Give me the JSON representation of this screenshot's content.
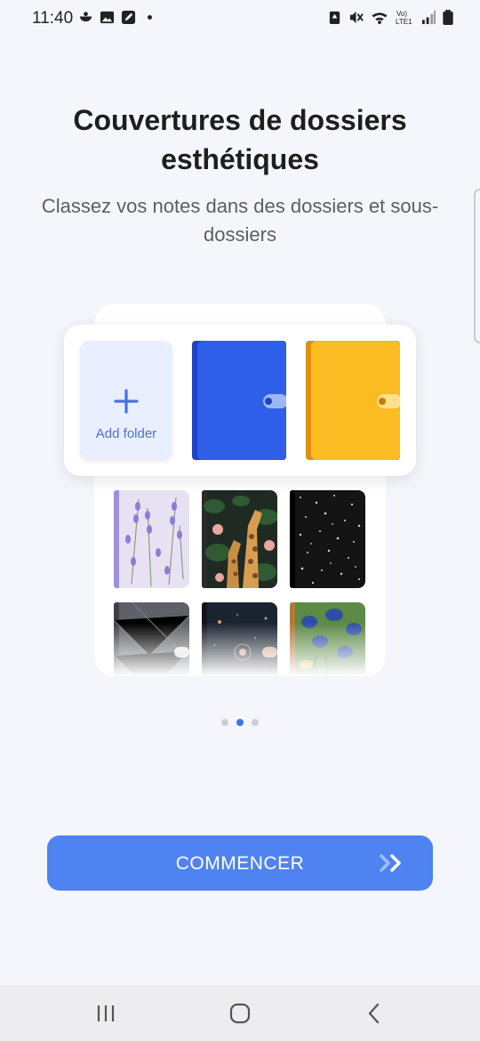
{
  "status_bar": {
    "time": "11:40",
    "left_icons": [
      "bowl-icon",
      "image-icon",
      "edit-note-icon",
      "notification-dot"
    ],
    "right_icons": [
      "recycle-icon",
      "mute-icon",
      "wifi-icon",
      "volte-lte-icon",
      "signal-icon",
      "battery-icon"
    ],
    "network_label": "Vo) LTE1"
  },
  "onboarding": {
    "title": "Couvertures de dossiers esthétiques",
    "subtitle": "Classez vos notes dans des dossiers et sous-dossiers",
    "add_folder_label": "Add folder",
    "page_count": 3,
    "active_page": 2
  },
  "covers": [
    "blue",
    "yellow",
    "lavender",
    "giraffe",
    "speckle",
    "grey-quilted",
    "night-sky",
    "irises"
  ],
  "colors": {
    "accent": "#4f83f1",
    "blue_folder": "#2f5fe8",
    "yellow_folder": "#fbbb22",
    "dot_active": "#3f74e6",
    "dot_inactive": "#c9ced8"
  },
  "cta": {
    "label": "COMMENCER",
    "icon": "double-chevron-right-icon"
  },
  "nav_bar": {
    "buttons": [
      "recent-apps-icon",
      "home-icon",
      "back-icon"
    ]
  }
}
